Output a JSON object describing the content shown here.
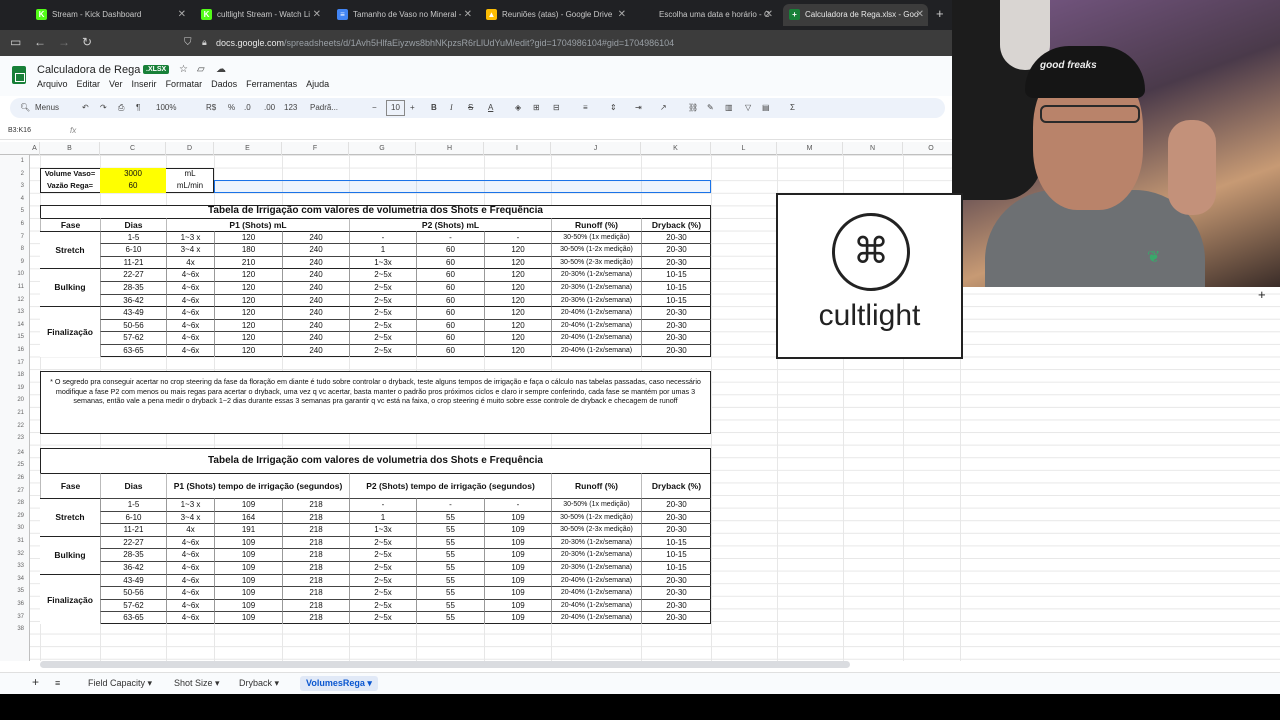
{
  "browser": {
    "tabs": [
      {
        "label": "Stream - Kick Dashboard",
        "fav": "K",
        "color": "#53fc18"
      },
      {
        "label": "cultlight Stream - Watch Li",
        "fav": "K",
        "color": "#53fc18"
      },
      {
        "label": "Tamanho de Vaso no Mineral - ",
        "fav": "≡",
        "color": "#4285f4"
      },
      {
        "label": "Reuniões (atas) - Google Drive",
        "fav": "▲",
        "color": "#fbbc04"
      },
      {
        "label": "Escolha uma data e horário - C",
        "fav": "",
        "color": "#202124"
      },
      {
        "label": "Calculadora de Rega.xlsx - Goo",
        "fav": "+",
        "color": "#188038"
      }
    ],
    "url_host": "docs.google.com",
    "url_path": "/spreadsheets/d/1Avh5HlfaEiyzws8bhNKpzsR6rLlUdYuM/edit?gid=1704986104#gid=1704986104"
  },
  "sheets": {
    "title": "Calculadora de Rega",
    "badge": ".XLSX",
    "menus": [
      "Arquivo",
      "Editar",
      "Ver",
      "Inserir",
      "Formatar",
      "Dados",
      "Ferramentas",
      "Ajuda"
    ],
    "toolbar": {
      "search": "Menus",
      "zoom": "100%",
      "currency": "R$",
      "percent": "%",
      "dec_down": ".0",
      "dec_up": ".00",
      "format123": "123",
      "font": "Padrã...",
      "font_size": "10"
    },
    "name_box": "B3:K16",
    "fx": "fx"
  },
  "columns": [
    "A",
    "B",
    "C",
    "D",
    "E",
    "F",
    "G",
    "H",
    "I",
    "J",
    "K",
    "L",
    "M",
    "N",
    "O"
  ],
  "rows": [
    "1",
    "2",
    "3",
    "4",
    "5",
    "6",
    "7",
    "8",
    "9",
    "10",
    "11",
    "12",
    "13",
    "14",
    "15",
    "16",
    "17",
    "18",
    "19",
    "20",
    "21",
    "22",
    "23",
    "24",
    "25",
    "26",
    "27",
    "28",
    "29",
    "30",
    "31",
    "32",
    "33",
    "34",
    "35",
    "36",
    "37",
    "38"
  ],
  "inputs": {
    "vol_label": "Volume Vaso=",
    "vol_value": "3000",
    "vol_unit": "mL",
    "vaz_label": "Vazão Rega=",
    "vaz_value": "60",
    "vaz_unit": "mL/min"
  },
  "table1": {
    "title": "Tabela de Irrigação com valores de volumetria dos Shots e Frequência",
    "headers": {
      "fase": "Fase",
      "dias": "Dias",
      "p1": "P1 (Shots) mL",
      "p2": "P2 (Shots) mL",
      "runoff": "Runoff (%)",
      "dryback": "Dryback (%)"
    },
    "phases": [
      "Stretch",
      "Bulking",
      "Finalização"
    ],
    "rows": [
      [
        "1-5",
        "1~3 x",
        "120",
        "240",
        "-",
        "-",
        "-",
        "30-50% (1x medição)",
        "20-30"
      ],
      [
        "6-10",
        "3~4 x",
        "180",
        "240",
        "1",
        "60",
        "120",
        "30-50% (1-2x medição)",
        "20-30"
      ],
      [
        "11-21",
        "4x",
        "210",
        "240",
        "1~3x",
        "60",
        "120",
        "30-50% (2-3x medição)",
        "20-30"
      ],
      [
        "22-27",
        "4~6x",
        "120",
        "240",
        "2~5x",
        "60",
        "120",
        "20-30% (1-2x/semana)",
        "10-15"
      ],
      [
        "28-35",
        "4~6x",
        "120",
        "240",
        "2~5x",
        "60",
        "120",
        "20-30% (1-2x/semana)",
        "10-15"
      ],
      [
        "36-42",
        "4~6x",
        "120",
        "240",
        "2~5x",
        "60",
        "120",
        "20-30% (1-2x/semana)",
        "10-15"
      ],
      [
        "43-49",
        "4~6x",
        "120",
        "240",
        "2~5x",
        "60",
        "120",
        "20-40% (1-2x/semana)",
        "20-30"
      ],
      [
        "50-56",
        "4~6x",
        "120",
        "240",
        "2~5x",
        "60",
        "120",
        "20-40% (1-2x/semana)",
        "20-30"
      ],
      [
        "57-62",
        "4~6x",
        "120",
        "240",
        "2~5x",
        "60",
        "120",
        "20-40% (1-2x/semana)",
        "20-30"
      ],
      [
        "63-65",
        "4~6x",
        "120",
        "240",
        "2~5x",
        "60",
        "120",
        "20-40% (1-2x/semana)",
        "20-30"
      ]
    ]
  },
  "note": "* O segredo pra conseguir acertar no crop steering da fase da floração em diante é tudo sobre controlar o dryback, teste alguns tempos de irrigação e faça o cálculo nas tabelas passadas, caso necessário modifique a fase P2 com menos ou mais regas para acertar o dryback, uma vez q vc acertar, basta manter o padrão pros próximos ciclos e claro ir sempre conferindo, cada fase se mantém por umas 3 semanas, então vale a pena medir o dryback 1~2 dias durante essas 3 semanas pra garantir q vc está na faixa, o crop steering é muito sobre esse controle de dryback e checagem de runoff",
  "table2": {
    "title": "Tabela de Irrigação com valores de volumetria dos Shots e Frequência",
    "headers": {
      "fase": "Fase",
      "dias": "Dias",
      "p1": "P1 (Shots) tempo de irrigação (segundos)",
      "p2": "P2 (Shots) tempo de irrigação (segundos)",
      "runoff": "Runoff (%)",
      "dryback": "Dryback (%)"
    },
    "phases": [
      "Stretch",
      "Bulking",
      "Finalização"
    ],
    "rows": [
      [
        "1-5",
        "1~3 x",
        "109",
        "218",
        "-",
        "-",
        "-",
        "30-50% (1x medição)",
        "20-30"
      ],
      [
        "6-10",
        "3~4 x",
        "164",
        "218",
        "1",
        "55",
        "109",
        "30-50% (1-2x medição)",
        "20-30"
      ],
      [
        "11-21",
        "4x",
        "191",
        "218",
        "1~3x",
        "55",
        "109",
        "30-50% (2-3x medição)",
        "20-30"
      ],
      [
        "22-27",
        "4~6x",
        "109",
        "218",
        "2~5x",
        "55",
        "109",
        "20-30% (1-2x/semana)",
        "10-15"
      ],
      [
        "28-35",
        "4~6x",
        "109",
        "218",
        "2~5x",
        "55",
        "109",
        "20-30% (1-2x/semana)",
        "10-15"
      ],
      [
        "36-42",
        "4~6x",
        "109",
        "218",
        "2~5x",
        "55",
        "109",
        "20-30% (1-2x/semana)",
        "10-15"
      ],
      [
        "43-49",
        "4~6x",
        "109",
        "218",
        "2~5x",
        "55",
        "109",
        "20-40% (1-2x/semana)",
        "20-30"
      ],
      [
        "50-56",
        "4~6x",
        "109",
        "218",
        "2~5x",
        "55",
        "109",
        "20-40% (1-2x/semana)",
        "20-30"
      ],
      [
        "57-62",
        "4~6x",
        "109",
        "218",
        "2~5x",
        "55",
        "109",
        "20-40% (1-2x/semana)",
        "20-30"
      ],
      [
        "63-65",
        "4~6x",
        "109",
        "218",
        "2~5x",
        "55",
        "109",
        "20-40% (1-2x/semana)",
        "20-30"
      ]
    ]
  },
  "overlay": {
    "logo_word": "cultlight",
    "cap_text": "good freaks"
  },
  "sheet_tabs": [
    "Field Capacity",
    "Shot Size",
    "Dryback",
    "VolumesRega"
  ],
  "colors": {
    "yellow": "#ffff00",
    "sheets_green": "#188038",
    "active_blue": "#0b57d0"
  }
}
